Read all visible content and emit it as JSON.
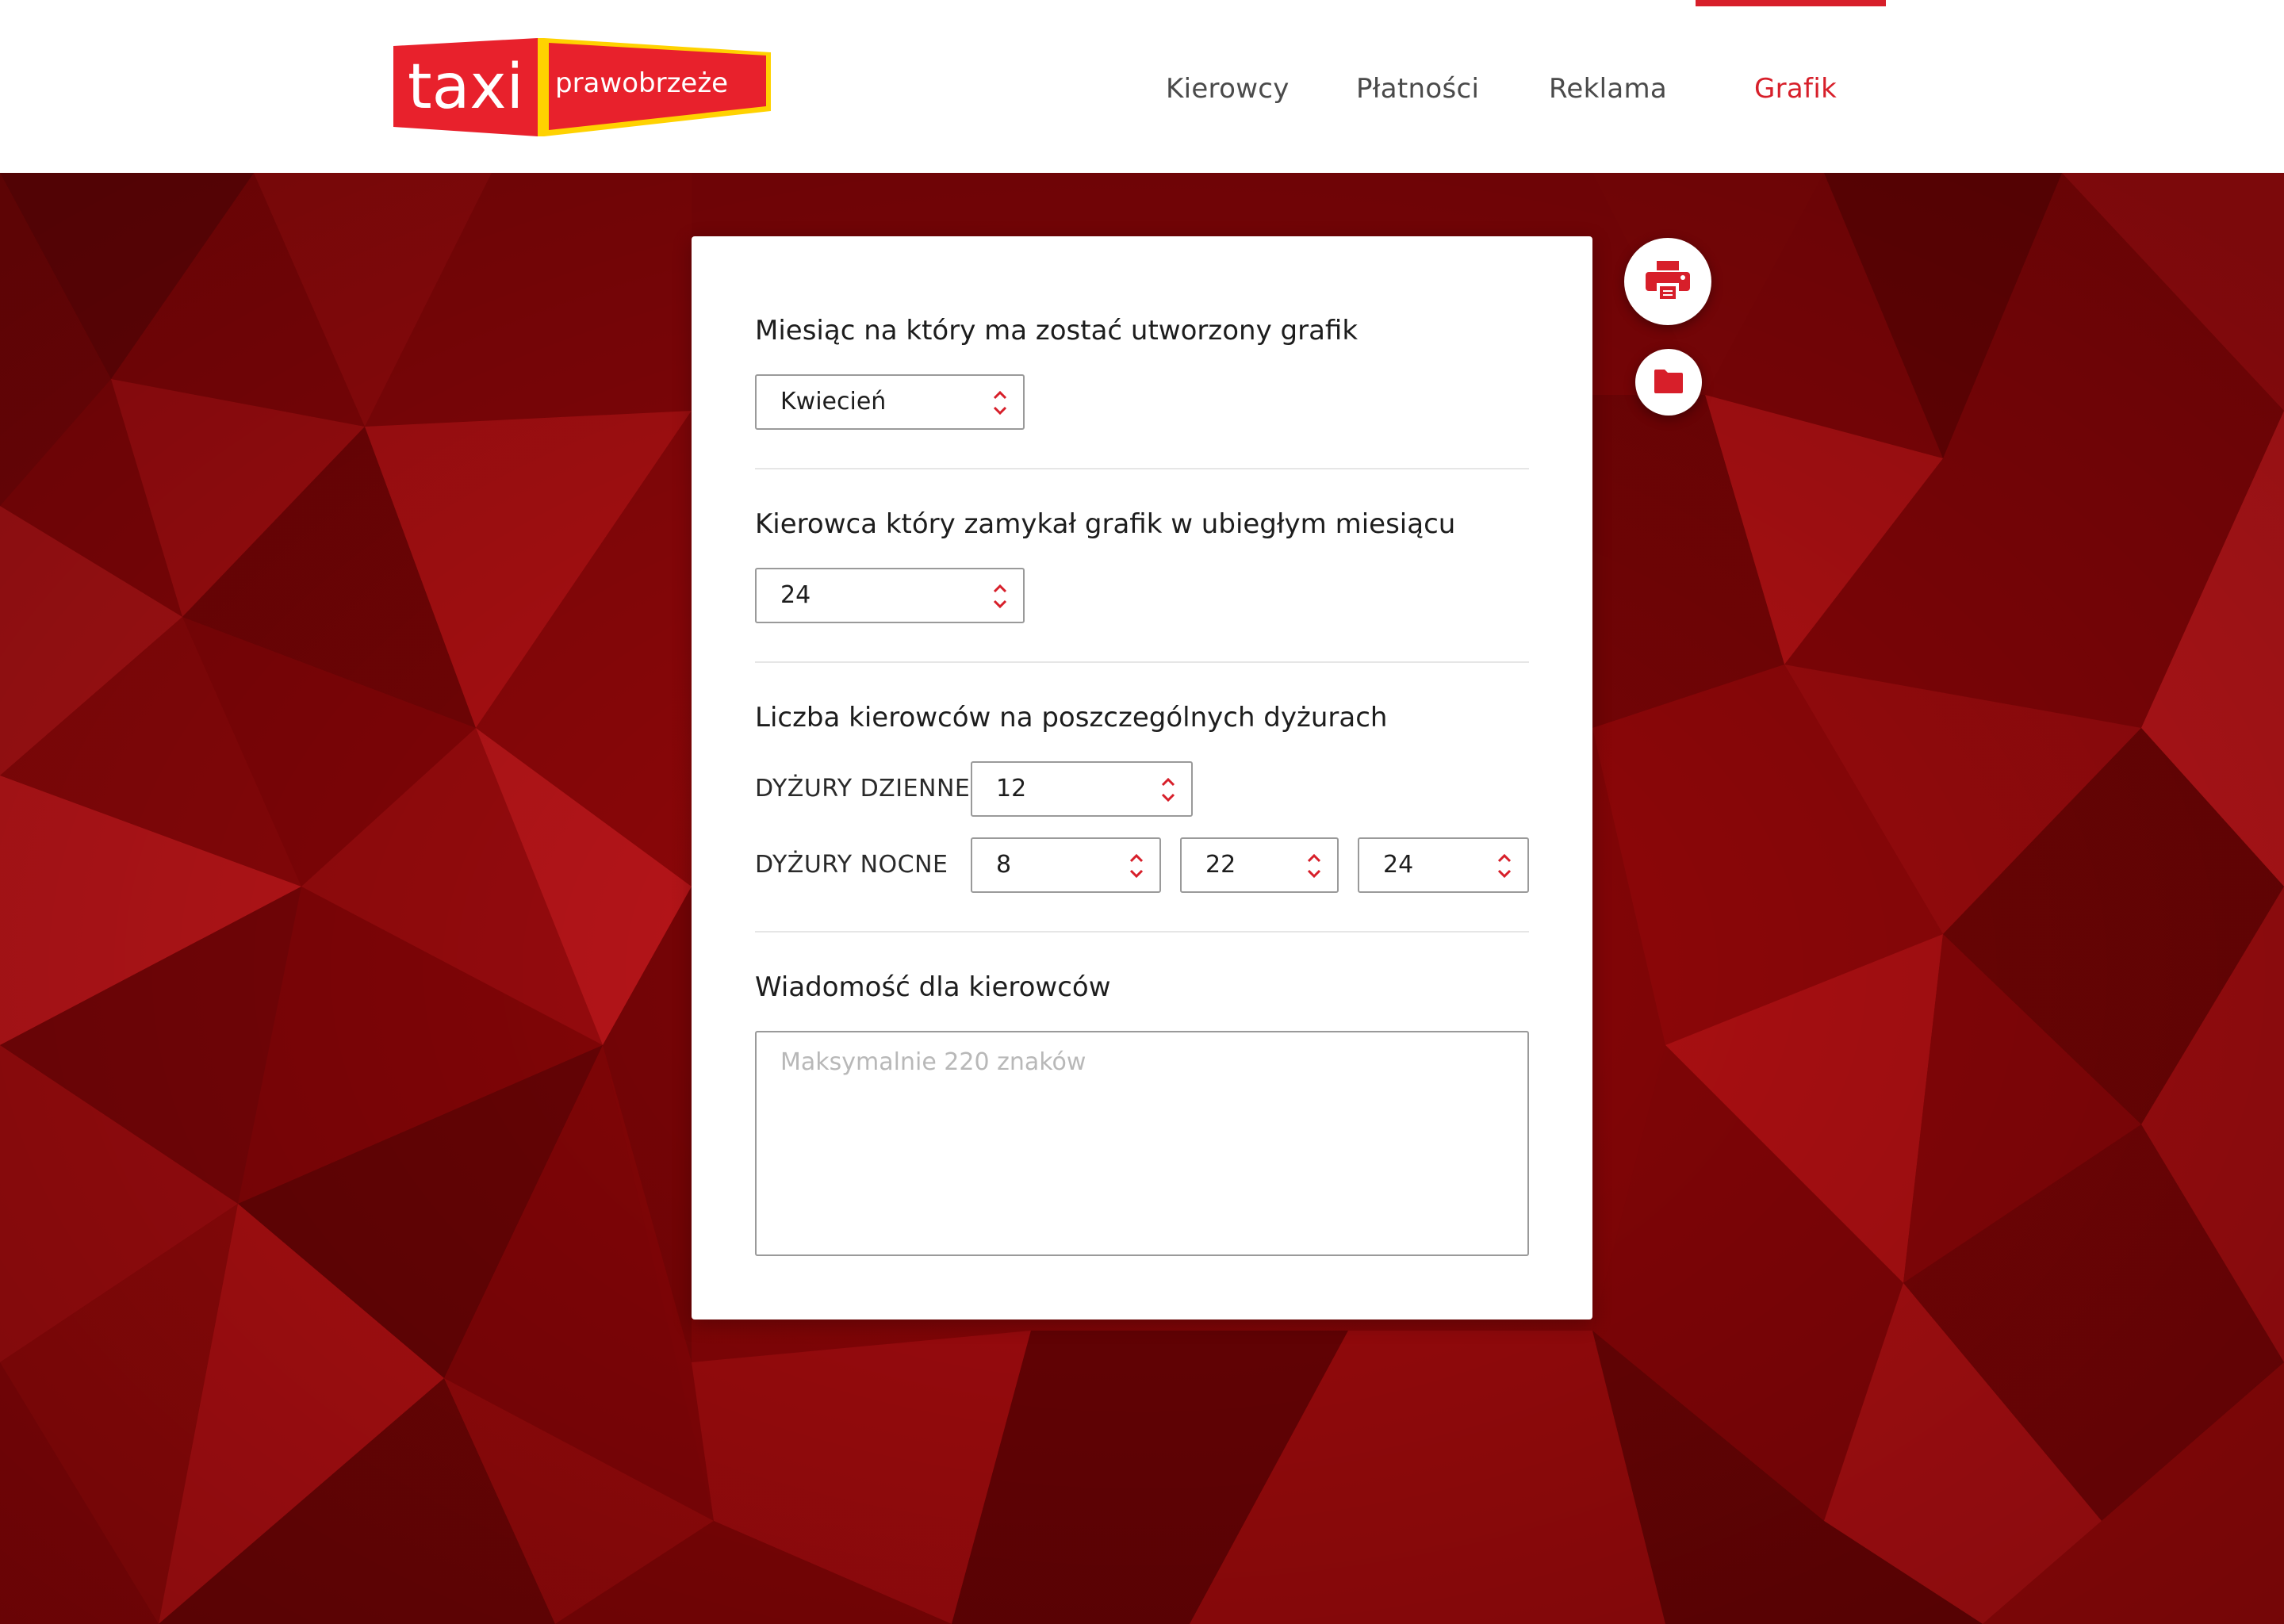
{
  "header": {
    "logo": {
      "word": "taxi",
      "brand": "prawobrzeże"
    },
    "nav": [
      {
        "label": "Kierowcy",
        "active": false
      },
      {
        "label": "Płatności",
        "active": false
      },
      {
        "label": "Reklama",
        "active": false
      },
      {
        "label": "Grafik",
        "active": true
      }
    ]
  },
  "form": {
    "month": {
      "label": "Miesiąc na który ma zostać utworzony grafik",
      "value": "Kwiecień"
    },
    "last_driver": {
      "label": "Kierowca który zamykał grafik w ubiegłym miesiącu",
      "value": "24"
    },
    "drivers_count": {
      "label": "Liczba kierowców na poszczególnych dyżurach",
      "day_label": "DYŻURY DZIENNE",
      "day_value": "12",
      "night_label": "DYŻURY NOCNE",
      "night_values": [
        "8",
        "22",
        "24"
      ]
    },
    "message": {
      "label": "Wiadomość dla kierowców",
      "value": "",
      "placeholder": "Maksymalnie 220 znaków"
    }
  },
  "actions": {
    "print_icon": "print-icon",
    "folder_icon": "folder-icon"
  },
  "colors": {
    "accent": "#d71f2a",
    "logo_yellow": "#ffd200",
    "background": "#8c0508",
    "nav_text": "#4a4a4a"
  }
}
